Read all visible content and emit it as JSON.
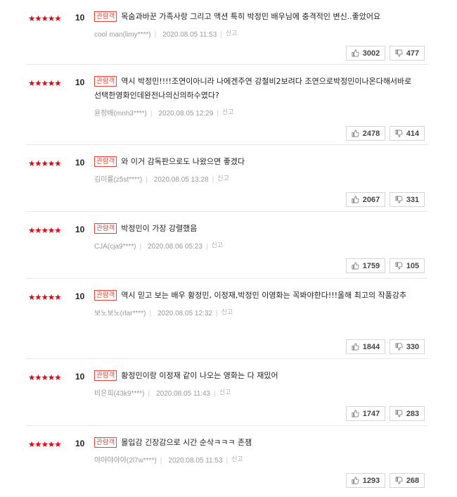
{
  "reviews": [
    {
      "rating_stars": "★★★★★",
      "score": "10",
      "badge": "관람객",
      "text": "목숨과바꾼 가족사랑 그리고 액션 특히 박정민 배우님에 충격적인 변신..좋았어요",
      "author": "cool man(limy****)",
      "date": "2020.08.05 11:53",
      "report": "신고",
      "likes": "3002",
      "dislikes": "477"
    },
    {
      "rating_stars": "★★★★★",
      "score": "10",
      "badge": "관람객",
      "text": "역시 박정민!!!!조연이아니라 나에겐주연 강철비2보려다 조연으로박정민이나온다해서바로선택한영화인데완전나의신의하수였다?",
      "author": "윤정배(mnh3****)",
      "date": "2020.08.05 12:29",
      "report": "신고",
      "likes": "2478",
      "dislikes": "414"
    },
    {
      "rating_stars": "★★★★★",
      "score": "10",
      "badge": "관람객",
      "text": "와 이거 감독판으로도 나왔으면 좋겠다",
      "author": "김미를(z5st****)",
      "date": "2020.08.05 13:28",
      "report": "신고",
      "likes": "2067",
      "dislikes": "331"
    },
    {
      "rating_stars": "★★★★★",
      "score": "10",
      "badge": "관람객",
      "text": "박정민이 가장 강렬했음",
      "author": "CJA(cja9****)",
      "date": "2020.08.06 05:23",
      "report": "신고",
      "likes": "1759",
      "dislikes": "105"
    },
    {
      "rating_stars": "★★★★★",
      "score": "10",
      "badge": "관람객",
      "text": "역시 믿고 보는 배우 황정민, 이정재,박정민 이영화는 꼭봐야한다!!!올해 최고의 작품강추",
      "author": "보노보노(rlar****)",
      "date": "2020.08.05 12:32",
      "report": "신고",
      "likes": "1844",
      "dislikes": "330"
    },
    {
      "rating_stars": "★★★★★",
      "score": "10",
      "badge": "관람객",
      "text": "황정민이랑 이정재 같이 나오는 영화는 다 재밌어",
      "author": "비은희(43k9****)",
      "date": "2020.08.05 11:43",
      "report": "신고",
      "likes": "1747",
      "dislikes": "283"
    },
    {
      "rating_stars": "★★★★★",
      "score": "10",
      "badge": "관람객",
      "text": "몰입감 긴장감으로 시간 순삭ㅋㅋㅋ 존잼",
      "author": "야야야야야(2l7w****)",
      "date": "2020.08.05 11:53",
      "report": "신고",
      "likes": "1293",
      "dislikes": "268"
    }
  ],
  "colors": {
    "accent": "#e60012",
    "badge": "#e2463b",
    "meta": "#999999"
  },
  "icons": {
    "like": "thumbs-up-icon",
    "dislike": "thumbs-down-icon"
  }
}
